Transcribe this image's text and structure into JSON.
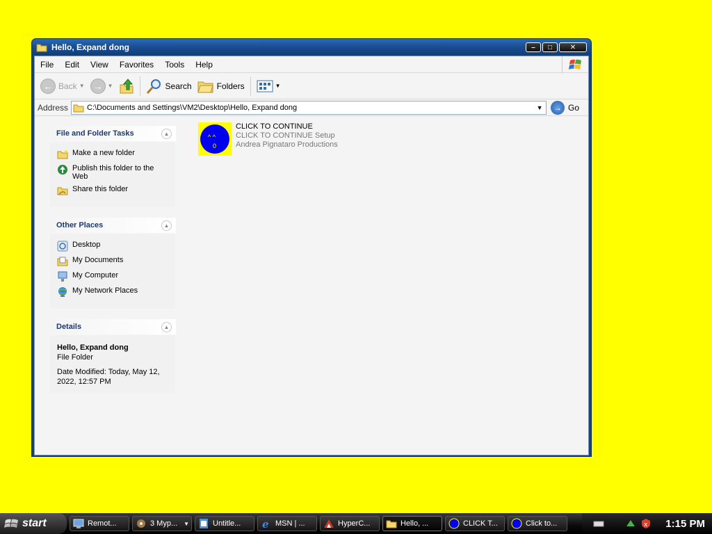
{
  "window": {
    "title": "Hello, Expand dong",
    "controls": {
      "minimize": "–",
      "maximize": "□",
      "close": "✕"
    }
  },
  "menu": {
    "items": [
      "File",
      "Edit",
      "View",
      "Favorites",
      "Tools",
      "Help"
    ]
  },
  "toolbar": {
    "back": "Back",
    "search": "Search",
    "folders": "Folders"
  },
  "address": {
    "label": "Address",
    "value": "C:\\Documents and Settings\\VM2\\Desktop\\Hello, Expand dong",
    "go": "Go"
  },
  "taskpane": {
    "file_tasks": {
      "title": "File and Folder Tasks",
      "items": [
        {
          "label": "Make a new folder",
          "icon": "new-folder-icon"
        },
        {
          "label": "Publish this folder to the Web",
          "icon": "publish-web-icon"
        },
        {
          "label": "Share this folder",
          "icon": "share-folder-icon"
        }
      ]
    },
    "other_places": {
      "title": "Other Places",
      "items": [
        {
          "label": "Desktop",
          "icon": "desktop-icon"
        },
        {
          "label": "My Documents",
          "icon": "my-documents-icon"
        },
        {
          "label": "My Computer",
          "icon": "my-computer-icon"
        },
        {
          "label": "My Network Places",
          "icon": "network-places-icon"
        }
      ]
    },
    "details": {
      "title": "Details",
      "name": "Hello, Expand dong",
      "type": "File Folder",
      "date": "Date Modified: Today, May 12, 2022, 12:57 PM"
    }
  },
  "files": [
    {
      "name": "CLICK TO CONTINUE",
      "description": "CLICK TO CONTINUE Setup",
      "company": "Andrea Pignataro Productions",
      "icon": "blue-face-icon",
      "face": {
        "eyes": "^  ^",
        "mouth": "0"
      }
    }
  ],
  "taskbar": {
    "start": "start",
    "buttons": [
      {
        "label": "Remot...",
        "icon": "remote-desktop-icon"
      },
      {
        "label": "3 Myp...",
        "icon": "mypaint-icon"
      },
      {
        "label": "Untitle...",
        "icon": "untitled-doc-icon"
      },
      {
        "label": "MSN | ...",
        "icon": "ie-icon"
      },
      {
        "label": "HyperC...",
        "icon": "hyperc-icon"
      },
      {
        "label": "Hello, ...",
        "icon": "folder-icon",
        "active": true
      },
      {
        "label": "CLICK T...",
        "icon": "blue-face-icon"
      },
      {
        "label": "Click to...",
        "icon": "blue-face-icon"
      }
    ],
    "clock": "1:15 PM"
  },
  "colors": {
    "desktop": "#ffff00",
    "title_blue": "#1a4f93",
    "face_blue": "#0000ee"
  }
}
